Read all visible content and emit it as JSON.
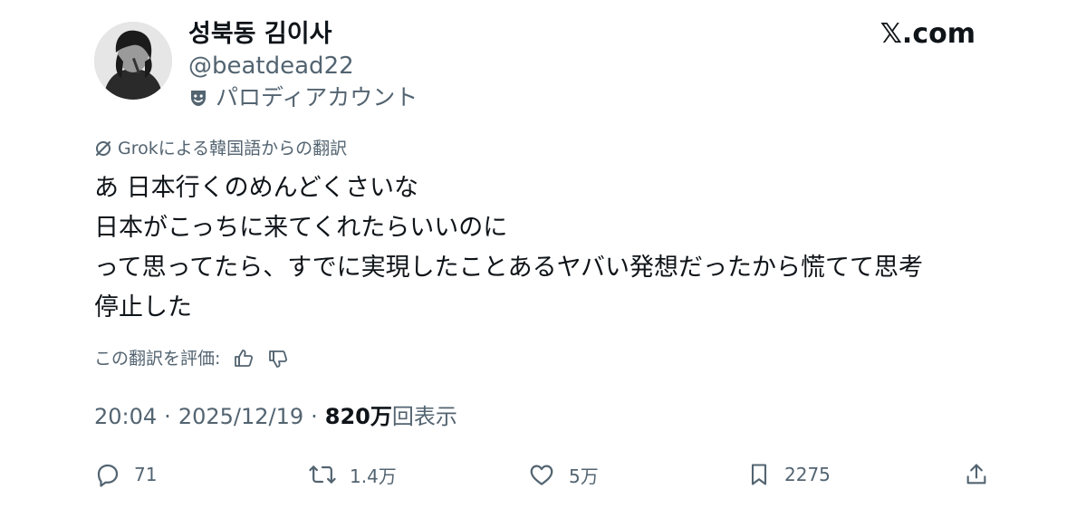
{
  "author": {
    "display_name": "성북동 김이사",
    "handle": "@beatdead22",
    "parody_label": "パロディアカウント"
  },
  "brand": "𝕏.com",
  "translation": {
    "note": "Grokによる韓国語からの翻訳",
    "rate_label": "この翻訳を評価:"
  },
  "tweet": {
    "lines": [
      "あ 日本行くのめんどくさいな",
      "日本がこっちに来てくれたらいいのに",
      "って思ってたら、すでに実現したことあるヤバい発想だったから慌てて思考",
      "停止した"
    ]
  },
  "meta": {
    "time": "20:04",
    "separator": "·",
    "date": "2025/12/19",
    "views_count": "820万",
    "views_label": "回表示"
  },
  "actions": {
    "replies": "71",
    "reposts": "1.4万",
    "likes": "5万",
    "bookmarks": "2275"
  },
  "icons": {
    "grok": "grok-icon",
    "parody": "theater-mask-icon",
    "thumbs_up": "thumbs-up-icon",
    "thumbs_down": "thumbs-down-icon",
    "reply": "reply-bubble-icon",
    "repost": "repost-icon",
    "like": "heart-icon",
    "bookmark": "bookmark-icon",
    "share": "share-icon"
  },
  "colors": {
    "text_primary": "#0f1419",
    "text_secondary": "#536471",
    "background": "#ffffff"
  }
}
